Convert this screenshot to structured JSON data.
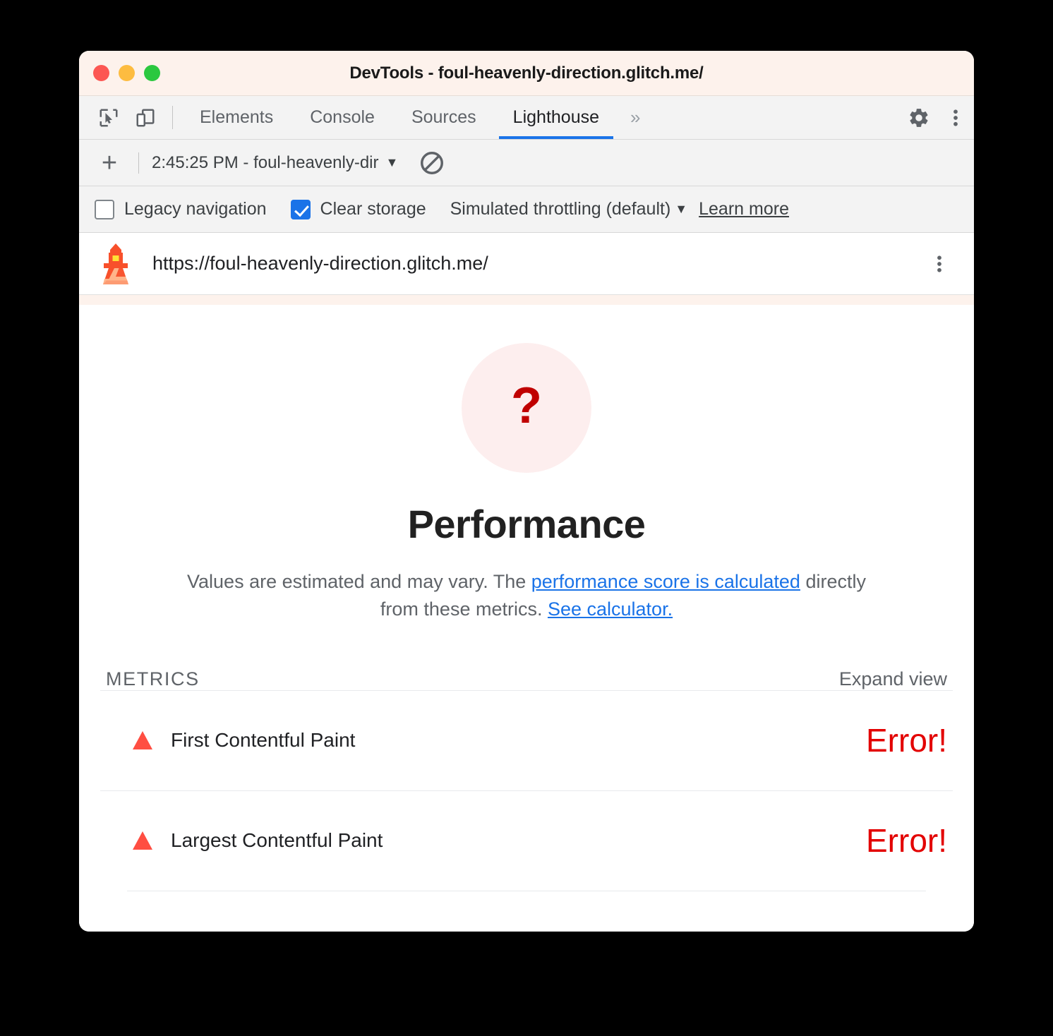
{
  "window": {
    "title": "DevTools - foul-heavenly-direction.glitch.me/",
    "traffic_lights": [
      "close",
      "minimize",
      "zoom"
    ],
    "colors": {
      "titlebar_bg": "#fdf2ec",
      "accent_blue": "#1a73e8",
      "error_red": "#e30000",
      "triangle_red": "#ff4e42",
      "gauge_bg": "#fdeeee",
      "gauge_fg": "#c00000"
    }
  },
  "tabstrip": {
    "left_icons": [
      {
        "name": "inspect-element-icon",
        "label": "Inspect"
      },
      {
        "name": "device-toolbar-icon",
        "label": "Toggle device toolbar"
      }
    ],
    "tabs": [
      {
        "label": "Elements",
        "active": false
      },
      {
        "label": "Console",
        "active": false
      },
      {
        "label": "Sources",
        "active": false
      },
      {
        "label": "Lighthouse",
        "active": true
      }
    ],
    "more_tabs": "»",
    "right_icons": [
      {
        "name": "gear-icon",
        "label": "Settings"
      },
      {
        "name": "kebab-menu-icon",
        "label": "Customize and control DevTools"
      }
    ]
  },
  "lighthouse_toolbar": {
    "new_run_label": "+",
    "run_select_value": "2:45:25 PM - foul-heavenly-dir",
    "run_select_caret": "▼",
    "clear_all_label": "Clear all"
  },
  "lighthouse_settings": {
    "legacy_navigation": {
      "label": "Legacy navigation",
      "checked": false
    },
    "clear_storage": {
      "label": "Clear storage",
      "checked": true
    },
    "throttling": {
      "value": "Simulated throttling (default)",
      "caret": "▼"
    },
    "learn_more": "Learn more"
  },
  "report_header": {
    "icon": "lighthouse-logo-icon",
    "url": "https://foul-heavenly-direction.glitch.me/",
    "menu": "kebab-menu-icon"
  },
  "report": {
    "gauge_value": "?",
    "category_title": "Performance",
    "description": {
      "part1": "Values are estimated and may vary. The ",
      "link1": "performance score is calculated",
      "part2": " directly from these metrics. ",
      "link2": "See calculator."
    },
    "metrics_label": "METRICS",
    "expand_view": "Expand view",
    "metrics": [
      {
        "status_icon": "error-triangle-icon",
        "name": "First Contentful Paint",
        "value": "Error!"
      },
      {
        "status_icon": "error-triangle-icon",
        "name": "Largest Contentful Paint",
        "value": "Error!"
      }
    ]
  }
}
